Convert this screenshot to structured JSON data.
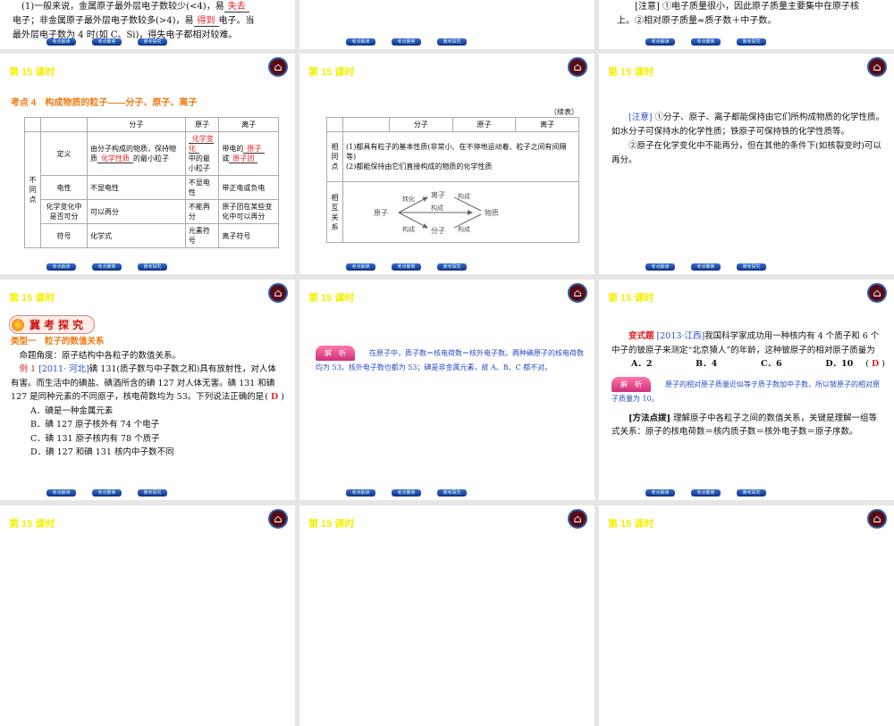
{
  "common": {
    "lesson": "第 15 课时",
    "home_icon": "home-icon",
    "nav": [
      "考点解读",
      "考点聚焦",
      "冀考探究"
    ]
  },
  "s0": {
    "line1": "(1)一般来说，金属原子最外层电子数较少(<4)，易",
    "blank1": "失去",
    "line2a": "电子；非金属原子最外层电子数较多(>4)，易",
    "blank2": "得到",
    "line2b": "电子。当",
    "line3": "最外层电子数为 4 时(如 C、Si)，得失电子都相对较难。"
  },
  "s2": {
    "line1": "[注意] ①电子质量很小，因此原子质量主要集中在原子核",
    "line2": "上。②相对原子质量≈质子数＋中子数。"
  },
  "s3": {
    "title": "考点 4　构成物质的粒子——分子、原子、离子",
    "headers": [
      "分子",
      "原子",
      "离子"
    ],
    "group": "不同点",
    "rows": [
      {
        "label": "定义",
        "molecule_pre": "由分子构成的物质，保持物质",
        "molecule_blank": "化学性质",
        "molecule_post": "的最小粒子",
        "atom_blank": "化学变化",
        "atom_post": "中的最小粒子",
        "ion_pre": "带电的",
        "ion_blank1": "原子",
        "ion_mid": "或",
        "ion_blank2": "原子团"
      },
      {
        "label": "电性",
        "molecule": "不显电性",
        "atom": "不显电性",
        "ion": "带正电或负电"
      },
      {
        "label": "化学变化中是否可分",
        "molecule": "可以再分",
        "atom": "不能再分",
        "ion": "原子团在某些变化中可以再分"
      },
      {
        "label": "符号",
        "molecule": "化学式",
        "atom": "元素符号",
        "ion": "离子符号"
      }
    ]
  },
  "s4": {
    "cont": "（续表）",
    "headers": [
      "分子",
      "原子",
      "离子"
    ],
    "same_label": "相同点",
    "same1": "(1)都具有粒子的基本性质(非常小、在不停地运动着、粒子之间有间隔等)",
    "same2": "(2)都能保持由它们直接构成的物质的化学性质",
    "rel_label": "相互关系",
    "diagram": {
      "atom": "原子",
      "ion": "离子",
      "molecule": "分子",
      "matter": "物质",
      "transform": "转化",
      "compose": "构成"
    }
  },
  "s5": {
    "note_tag": "[注意]",
    "p1": "①分子、原子、离子都能保持由它们所构成物质的化学性质。如水分子可保持水的化学性质；铁原子可保持铁的化学性质等。",
    "p2": "②原子在化学变化中不能再分，但在其他的条件下(如核裂变时)可以再分。"
  },
  "s6": {
    "section": "冀考探究",
    "type": "类型一　粒子的数值关系",
    "angle": "命题角度：原子结构中各粒子的数值关系。",
    "ex_label": "例 1",
    "ex_src": "[2011· 河北]",
    "ex_text": "碘 131(质子数与中子数之和)具有放射性，对人体有害。而生活中的碘盐、碘酒所含的碘 127 对人体无害。碘 131 和碘 127 是同种元素的不同原子，核电荷数均为 53。下列说法正确的是",
    "answer": "D",
    "options": [
      "A．碘是一种金属元素",
      "B．碘 127 原子核外有 74 个电子",
      "C．碘 131 原子核内有 78 个质子",
      "D．碘 127 和碘 131 核内中子数不同"
    ]
  },
  "s7": {
    "tag": "解　析",
    "text": "在原子中，质子数＝核电荷数＝核外电子数。两种碘原子的核电荷数均为 53，核外电子数也都为 53；碘是非金属元素，故 A、B、C 都不对。"
  },
  "s8": {
    "label": "变式题",
    "src": "[2013·江西]",
    "text": "我国科学家成功用一种核内有 4 个质子和 6 个中子的铍原子来测定“北京猿人”的年龄，这种铍原子的相对原子质量为",
    "answer": "D",
    "options": [
      "A．2",
      "B．4",
      "C．6",
      "D．10"
    ],
    "tag": "解　析",
    "analysis": "原子的相对原子质量近似等于质子数加中子数，所以铍原子的相对原子质量为 10。",
    "method_label": "[方法点拨]",
    "method": "理解原子中各粒子之间的数值关系，关键是理解一组等式关系：原子的核电荷数＝核内质子数＝核外电子数＝原子序数。"
  }
}
